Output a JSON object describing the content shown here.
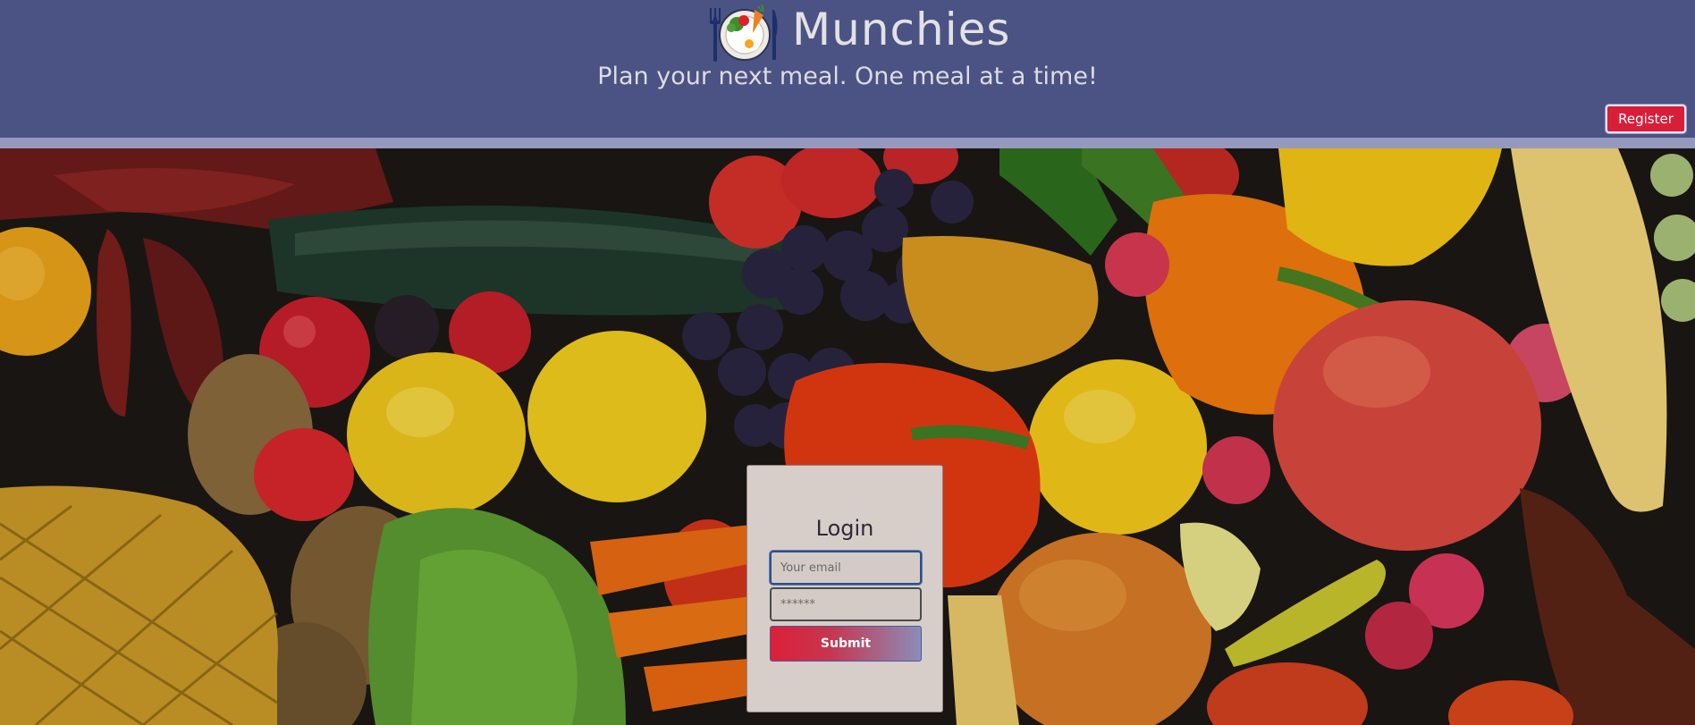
{
  "app": {
    "title": "Munchies",
    "subtitle": "Plan your next meal. One meal at a time!",
    "logo_icon": "plate-with-food-icon"
  },
  "nav": {
    "register_label": "Register"
  },
  "login": {
    "title": "Login",
    "email_placeholder": "Your email",
    "password_placeholder": "******",
    "submit_label": "Submit"
  },
  "colors": {
    "header_bg": "#4a5383",
    "accent": "#d91e3a"
  }
}
